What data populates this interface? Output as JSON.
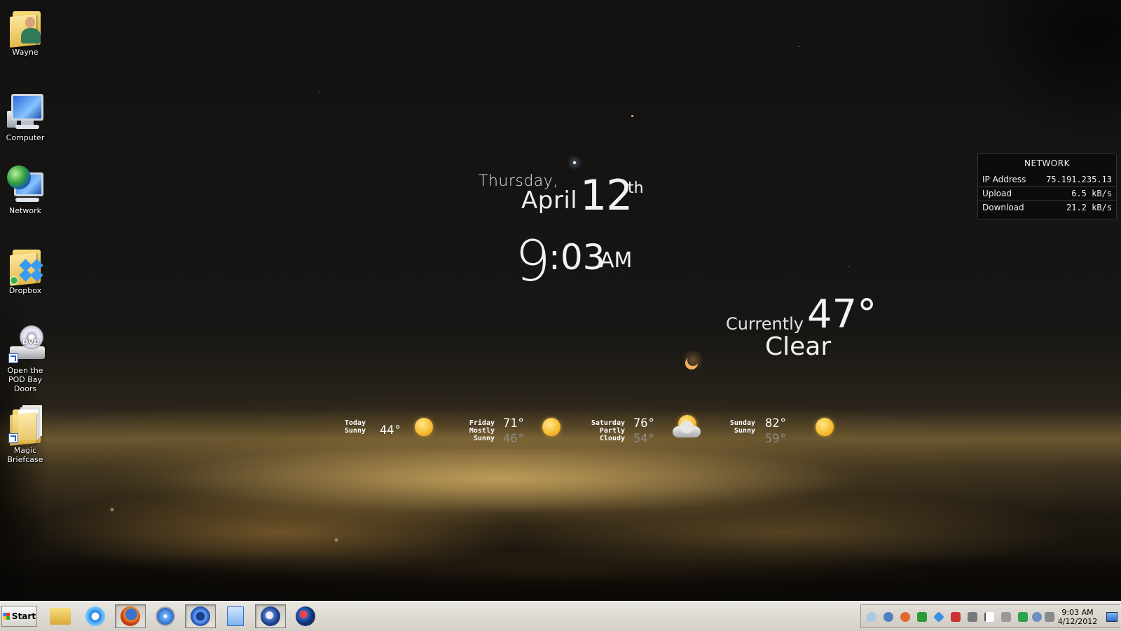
{
  "desktop_icons": [
    {
      "label": "Wayne"
    },
    {
      "label": "Computer"
    },
    {
      "label": "Network"
    },
    {
      "label": "Dropbox"
    },
    {
      "label": "Open the POD Bay Doors",
      "badge": "DVD"
    },
    {
      "label": "Magic Briefcase"
    }
  ],
  "clock": {
    "weekday": "Thursday,",
    "month": "April",
    "day": "12",
    "day_suffix": "th",
    "hour": "9",
    "minutes": ":03",
    "ampm": "AM"
  },
  "current_weather": {
    "label": "Currently",
    "temp": "47°",
    "condition": "Clear",
    "icon": "moon-icon"
  },
  "forecast": [
    {
      "day": "Today",
      "cond": "Sunny",
      "hi": "44°",
      "lo": "",
      "icon": "sun-icon"
    },
    {
      "day": "Friday",
      "cond": "Mostly Sunny",
      "hi": "71°",
      "lo": "46°",
      "icon": "mostly-sunny-icon"
    },
    {
      "day": "Saturday",
      "cond": "Partly Cloudy",
      "hi": "76°",
      "lo": "54°",
      "icon": "partly-cloudy-icon"
    },
    {
      "day": "Sunday",
      "cond": "Sunny",
      "hi": "82°",
      "lo": "59°",
      "icon": "sun-icon"
    }
  ],
  "network": {
    "title": "NETWORK",
    "rows": [
      {
        "label": "IP Address",
        "value": "75.191.235.13"
      },
      {
        "label": "Upload",
        "value": "6.5 kB/s"
      },
      {
        "label": "Download",
        "value": "21.2 kB/s"
      }
    ]
  },
  "taskbar": {
    "start_label": "Start",
    "quick_launch": [
      "explorer-icon",
      "internet-explorer-icon",
      "firefox-icon",
      "safari-icon",
      "itunes-icon",
      "notepad-icon",
      "thunderbird-icon",
      "rocket-icon"
    ],
    "tray_icons": [
      "droplet-icon",
      "globe-icon",
      "browser-icon",
      "arrow-icon",
      "dropbox-icon",
      "volume-icon",
      "network-icon",
      "flag-icon",
      "printer-icon",
      "sync-icon",
      "user-icon",
      "speaker-icon"
    ],
    "time": "9:03 AM",
    "date": "4/12/2012"
  }
}
